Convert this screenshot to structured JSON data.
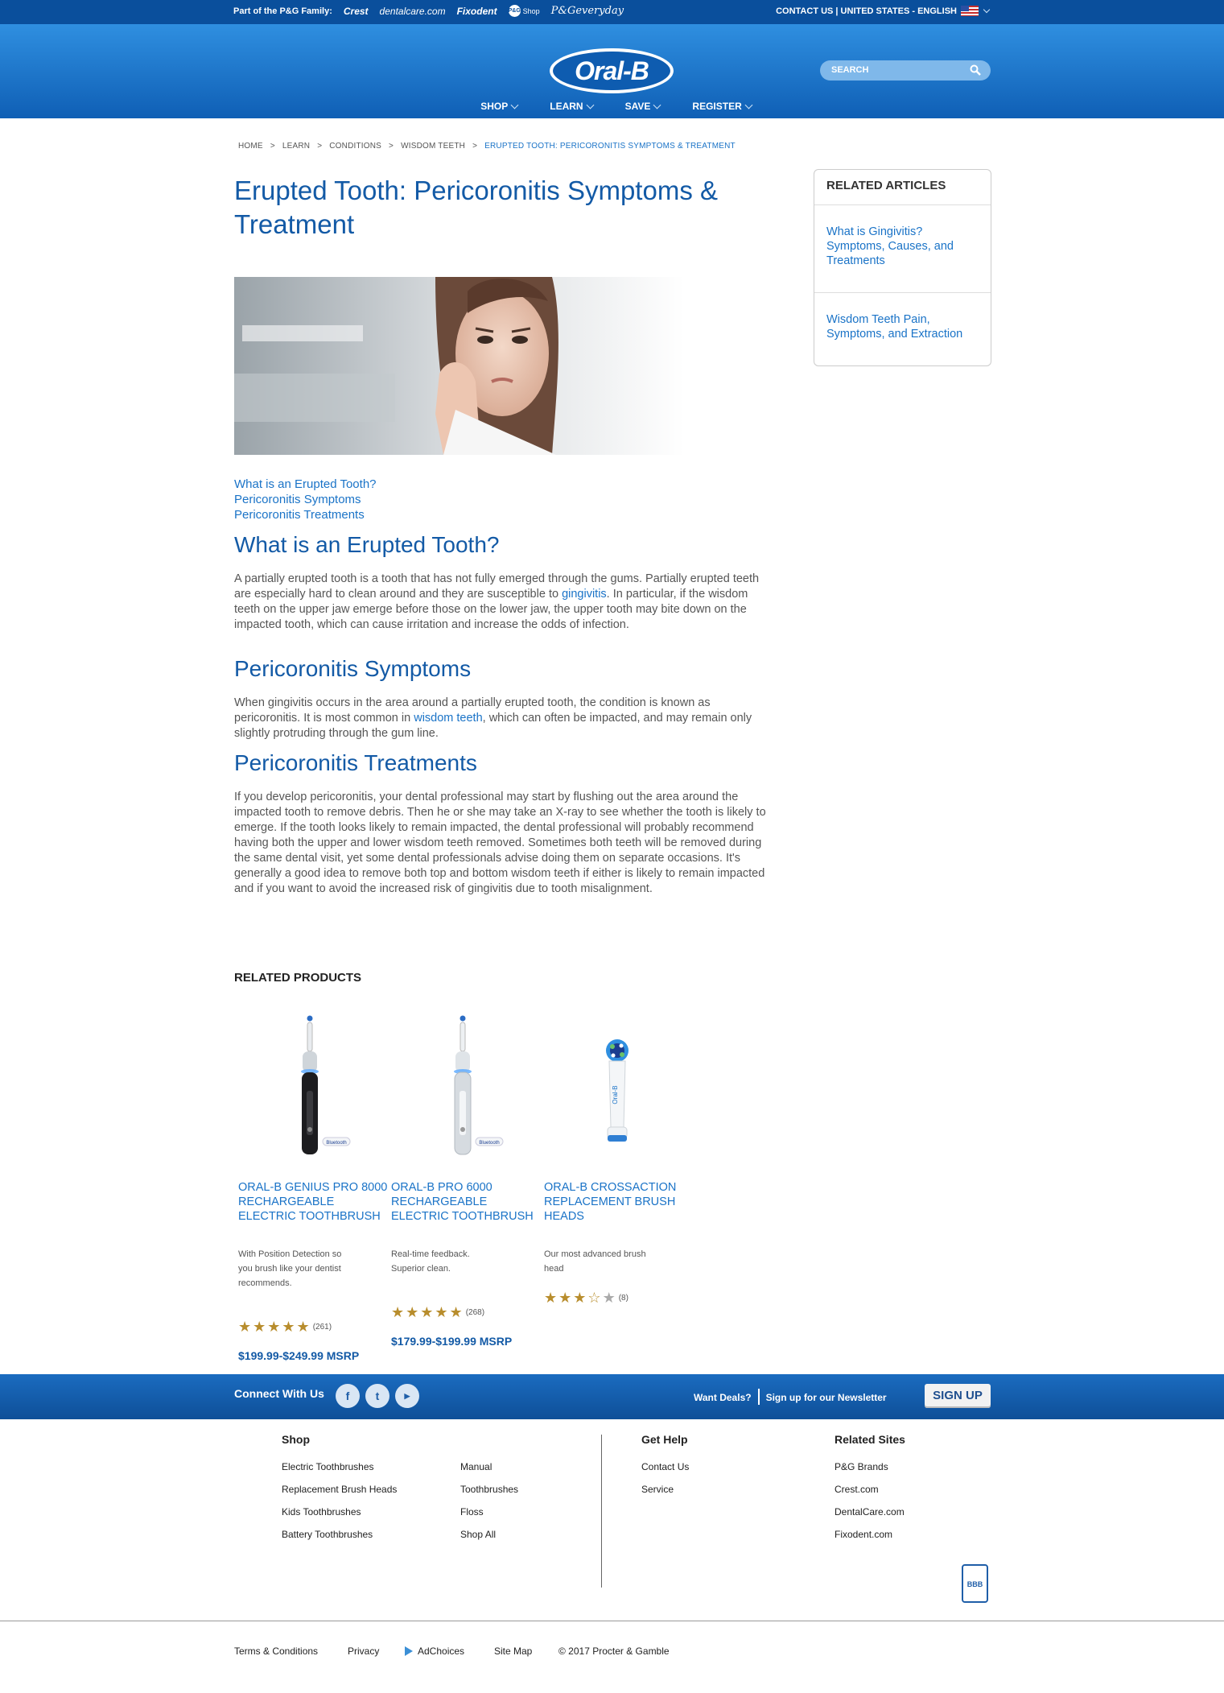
{
  "pg_bar": {
    "family_label": "Part of the P&G Family:",
    "brands": [
      "Crest",
      "dentalcare.com",
      "Fixodent",
      "P&G",
      "Shop",
      "P&Geveryday"
    ],
    "contact": "CONTACT US | UNITED STATES - ENGLISH"
  },
  "header": {
    "logo_text": "Oral-B",
    "search_placeholder": "SEARCH",
    "nav": [
      "SHOP",
      "LEARN",
      "SAVE",
      "REGISTER"
    ]
  },
  "breadcrumb": [
    "HOME",
    "LEARN",
    "CONDITIONS",
    "WISDOM TEETH",
    "ERUPTED TOOTH: PERICORONITIS SYMPTOMS & TREATMENT"
  ],
  "article": {
    "title": "Erupted Tooth: Pericoronitis Symptoms & Treatment",
    "toc": [
      "What is an Erupted Tooth?",
      "Pericoronitis Symptoms",
      "Pericoronitis Treatments"
    ],
    "s1_heading": "What is an Erupted Tooth?",
    "s1_text_a": "A partially erupted tooth is a tooth that has not fully emerged through the gums. Partially erupted teeth are especially hard to clean around and they are susceptible to ",
    "s1_link": "gingivitis",
    "s1_text_b": ". In particular, if the wisdom teeth on the upper jaw emerge before those on the lower jaw, the upper tooth may bite down on the impacted tooth, which can cause irritation and increase the odds of infection.",
    "s2_heading": "Pericoronitis Symptoms",
    "s2_text_a": "When gingivitis occurs in the area around a partially erupted tooth, the condition is known as pericoronitis. It is most common in ",
    "s2_link": "wisdom teeth",
    "s2_text_b": ", which can often be impacted, and may remain only slightly protruding through the gum line.",
    "s3_heading": "Pericoronitis Treatments",
    "s3_text": "If you develop pericoronitis, your dental professional may start by flushing out the area around the impacted tooth to remove debris. Then he or she may take an X-ray to see whether the tooth is likely to emerge. If the tooth looks likely to remain impacted, the dental professional will probably recommend having both the upper and lower wisdom teeth removed. Sometimes both teeth will be removed during the same dental visit, yet some dental professionals advise doing them on separate occasions. It's generally a good idea to remove both top and bottom wisdom teeth if either is likely to remain impacted and if you want to avoid the increased risk of gingivitis due to tooth misalignment."
  },
  "sidebar": {
    "heading": "RELATED ARTICLES",
    "items": [
      "What is Gingivitis? Symptoms, Causes, and Treatments",
      "Wisdom Teeth Pain, Symptoms, and Extraction"
    ]
  },
  "related_products": {
    "heading": "RELATED PRODUCTS",
    "items": [
      {
        "name": "ORAL-B GENIUS PRO 8000 RECHARGEABLE ELECTRIC TOOTHBRUSH",
        "desc": "With Position Detection so you brush like your dentist recommends.",
        "rating": 5,
        "count": "(261)",
        "price": "$199.99-$249.99 MSRP",
        "badge": "Bluetooth"
      },
      {
        "name": "ORAL-B PRO 6000 RECHARGEABLE ELECTRIC TOOTHBRUSH",
        "desc": "Real-time feedback. Superior clean.",
        "rating": 5,
        "count": "(268)",
        "price": "$179.99-$199.99 MSRP",
        "badge": "Bluetooth"
      },
      {
        "name": "ORAL-B CROSSACTION REPLACEMENT BRUSH HEADS",
        "desc": "Our most advanced brush head",
        "rating": 3.5,
        "count": "(8)",
        "price": ""
      }
    ]
  },
  "connect": {
    "label": "Connect With Us",
    "deals": "Want Deals?",
    "newsletter": "Sign up for our Newsletter",
    "signup": "SIGN UP"
  },
  "footer": {
    "shop_heading": "Shop",
    "shop_col1": [
      "Electric Toothbrushes",
      "Replacement Brush Heads",
      "Kids Toothbrushes",
      "Battery Toothbrushes"
    ],
    "shop_col2": [
      "Manual",
      "Toothbrushes",
      "Floss",
      "Shop All"
    ],
    "help_heading": "Get Help",
    "help_links": [
      "Contact Us",
      "Service"
    ],
    "related_heading": "Related Sites",
    "related_links": [
      "P&G Brands",
      "Crest.com",
      "DentalCare.com",
      "Fixodent.com"
    ],
    "bbb": "BBB",
    "legal": [
      "Terms & Conditions",
      "Privacy",
      "AdChoices",
      "Site Map",
      "© 2017 Procter & Gamble"
    ]
  }
}
